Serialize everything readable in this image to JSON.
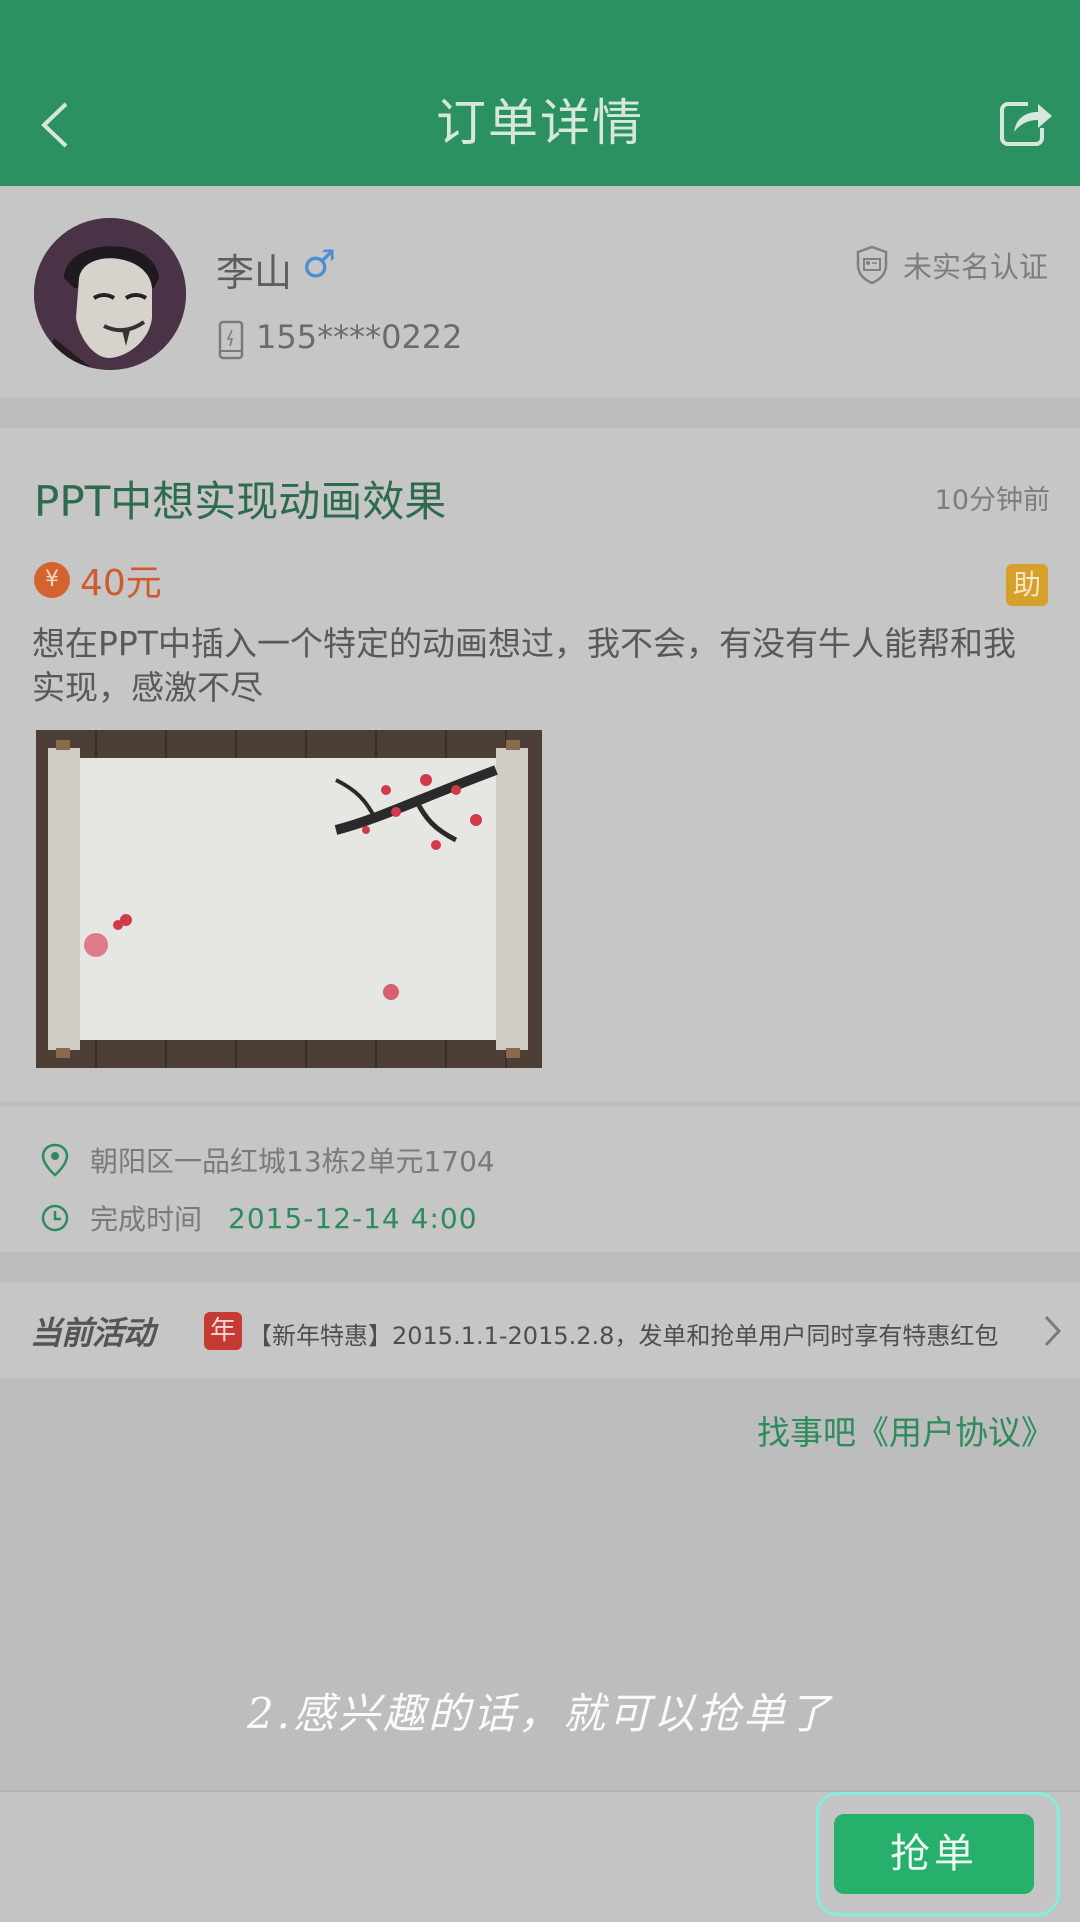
{
  "header": {
    "title": "订单详情",
    "back_icon": "chevron-left-icon",
    "share_icon": "share-icon"
  },
  "user": {
    "name": "李山",
    "gender_symbol": "♂",
    "phone": "155****0222",
    "verification": "未实名认证"
  },
  "order": {
    "title": "PPT中想实现动画效果",
    "time_ago": "10分钟前",
    "price_symbol": "¥",
    "price": "40元",
    "badge": "助",
    "description": "想在PPT中插入一个特定的动画想过，我不会，有没有牛人能帮和我实现，感激不尽"
  },
  "info": {
    "address": "朝阳区一品红城13栋2单元1704",
    "completion_label": "完成时间",
    "completion_time": "2015-12-14  4:00"
  },
  "activity": {
    "label": "当前活动",
    "badge": "年",
    "text": "【新年特惠】2015.1.1-2015.2.8，发单和抢单用户同时享有特惠红包"
  },
  "agreement": "找事吧《用户协议》",
  "caption": "2.感兴趣的话，就可以抢单了",
  "actions": {
    "grab_label": "抢单"
  },
  "colors": {
    "primary": "#2c9160",
    "accent_orange": "#cf5b2b",
    "button": "#26b06c"
  }
}
